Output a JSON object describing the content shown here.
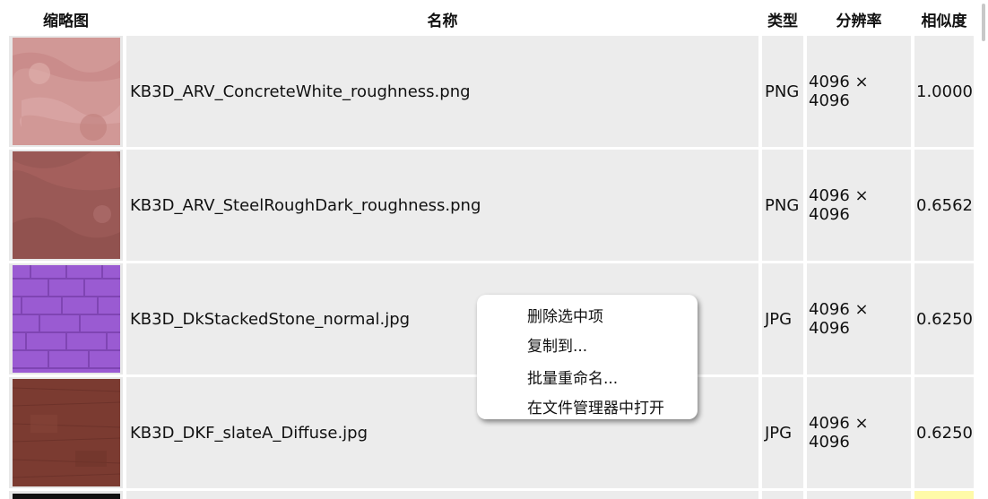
{
  "columns": {
    "thumbnail": "缩略图",
    "name": "名称",
    "type": "类型",
    "resolution": "分辨率",
    "similarity": "相似度"
  },
  "rows": [
    {
      "name": "KB3D_ARV_ConcreteWhite_roughness.png",
      "type": "PNG",
      "resolution": "4096 × 4096",
      "similarity": "1.0000",
      "thumb_color": "#d49a98"
    },
    {
      "name": "KB3D_ARV_SteelRoughDark_roughness.png",
      "type": "PNG",
      "resolution": "4096 × 4096",
      "similarity": "0.6562",
      "thumb_color": "#9a5a57"
    },
    {
      "name": "KB3D_DkStackedStone_normal.jpg",
      "type": "JPG",
      "resolution": "4096 × 4096",
      "similarity": "0.6250",
      "thumb_color": "#9a5bd0"
    },
    {
      "name": "KB3D_DKF_slateA_Diffuse.jpg",
      "type": "JPG",
      "resolution": "4096 × 4096",
      "similarity": "0.6250",
      "thumb_color": "#7a3a30"
    }
  ],
  "context_menu": {
    "items": [
      "删除选中项",
      "复制到...",
      "批量重命名...",
      "在文件管理器中打开"
    ]
  }
}
